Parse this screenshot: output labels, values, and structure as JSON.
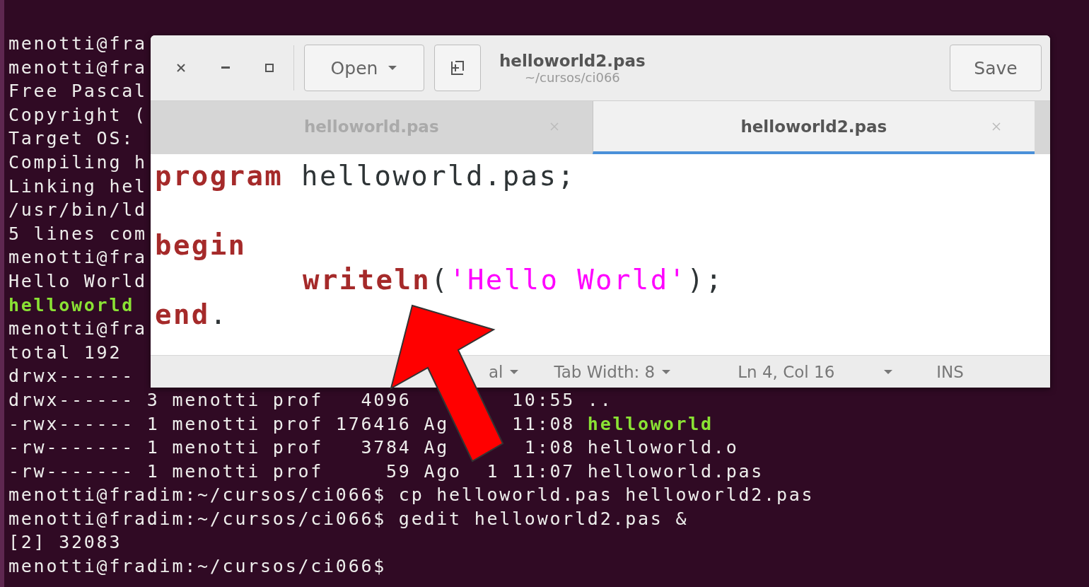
{
  "terminal": {
    "lines": [
      {
        "segments": [
          {
            "text": "menotti@fra",
            "kind": "normal"
          }
        ]
      },
      {
        "segments": [
          {
            "text": "menotti@fra",
            "kind": "normal"
          }
        ]
      },
      {
        "segments": [
          {
            "text": "Free Pascal",
            "kind": "normal"
          }
        ]
      },
      {
        "segments": [
          {
            "text": "Copyright (",
            "kind": "normal"
          }
        ]
      },
      {
        "segments": [
          {
            "text": "Target OS:",
            "kind": "normal"
          }
        ]
      },
      {
        "segments": [
          {
            "text": "Compiling h",
            "kind": "normal"
          }
        ]
      },
      {
        "segments": [
          {
            "text": "Linking hel",
            "kind": "normal"
          }
        ]
      },
      {
        "segments": [
          {
            "text": "/usr/bin/ld",
            "kind": "normal"
          }
        ]
      },
      {
        "segments": [
          {
            "text": "5 lines com",
            "kind": "normal"
          }
        ]
      },
      {
        "segments": [
          {
            "text": "menotti@fra",
            "kind": "normal"
          }
        ]
      },
      {
        "segments": [
          {
            "text": "Hello World",
            "kind": "normal"
          }
        ]
      },
      {
        "segments": [
          {
            "text": "helloworld",
            "kind": "executable"
          }
        ]
      },
      {
        "segments": [
          {
            "text": "menotti@fra",
            "kind": "normal"
          }
        ]
      },
      {
        "segments": [
          {
            "text": "total 192",
            "kind": "normal"
          }
        ]
      },
      {
        "segments": [
          {
            "text": "drwx------",
            "kind": "normal"
          }
        ]
      },
      {
        "segments": [
          {
            "text": "drwx------ 3 menotti prof   4096        10:55 ..",
            "kind": "normal"
          }
        ]
      },
      {
        "segments": [
          {
            "text": "-rwx------ 1 menotti prof 176416 Ag     11:08 ",
            "kind": "normal"
          },
          {
            "text": "helloworld",
            "kind": "executable"
          }
        ]
      },
      {
        "segments": [
          {
            "text": "-rw------- 1 menotti prof   3784 Ag      1:08 helloworld.o",
            "kind": "normal"
          }
        ]
      },
      {
        "segments": [
          {
            "text": "-rw------- 1 menotti prof     59 Ago  1 11:07 helloworld.pas",
            "kind": "normal"
          }
        ]
      },
      {
        "segments": [
          {
            "text": "menotti@fradim:~/cursos/ci066$ cp helloworld.pas helloworld2.pas",
            "kind": "normal"
          }
        ]
      },
      {
        "segments": [
          {
            "text": "menotti@fradim:~/cursos/ci066$ gedit helloworld2.pas &",
            "kind": "normal"
          }
        ]
      },
      {
        "segments": [
          {
            "text": "[2] 32083",
            "kind": "normal"
          }
        ]
      },
      {
        "segments": [
          {
            "text": "menotti@fradim:~/cursos/ci066$",
            "kind": "normal"
          }
        ]
      }
    ]
  },
  "editor_window": {
    "open_button": "Open",
    "title": "helloworld2.pas",
    "subtitle": "~/cursos/ci066",
    "save_button": "Save",
    "tabs": [
      {
        "label": "helloworld.pas",
        "selected": false
      },
      {
        "label": "helloworld2.pas",
        "selected": true
      }
    ],
    "code_lines": [
      {
        "kind": "header",
        "segments": [
          {
            "text": "program",
            "kind": "keyword"
          },
          {
            "text": " helloworld.pas;",
            "kind": "plain"
          }
        ]
      },
      {
        "kind": "block",
        "segments": [
          {
            "text": "begin",
            "kind": "keyword"
          }
        ]
      },
      {
        "kind": "indented",
        "segments": [
          {
            "text": "writeln",
            "kind": "keyword"
          },
          {
            "text": "(",
            "kind": "plain"
          },
          {
            "text": "'Hello World'",
            "kind": "string"
          },
          {
            "text": ");",
            "kind": "plain"
          }
        ]
      },
      {
        "kind": "block",
        "segments": [
          {
            "text": "end",
            "kind": "keyword"
          },
          {
            "text": ".",
            "kind": "plain"
          }
        ]
      }
    ],
    "status_bar": {
      "language": "al",
      "tab_width": "Tab Width: 8",
      "position": "Ln 4, Col 16",
      "mode": "INS"
    }
  }
}
